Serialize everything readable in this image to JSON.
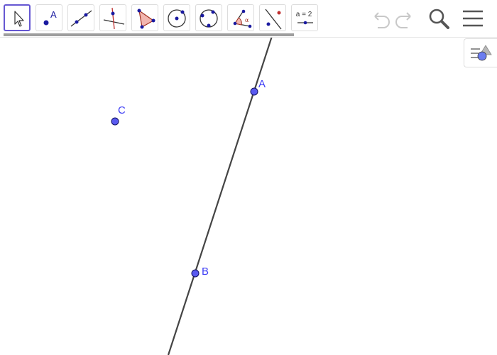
{
  "toolbar": {
    "tools": [
      {
        "name": "move-tool",
        "selected": true
      },
      {
        "name": "point-tool"
      },
      {
        "name": "line-tool"
      },
      {
        "name": "perpendicular-line-tool"
      },
      {
        "name": "polygon-tool"
      },
      {
        "name": "circle-tool"
      },
      {
        "name": "circle-through-3-points-tool"
      },
      {
        "name": "angle-tool"
      },
      {
        "name": "reflect-about-line-tool"
      },
      {
        "name": "slider-tool",
        "label": "a = 2"
      }
    ],
    "point_tool_label": "A",
    "angle_tool_label": "α"
  },
  "top_buttons": [
    "undo-icon",
    "redo-icon",
    "search-icon",
    "menu-icon"
  ],
  "style_bar_toggle": "style-bar-icon",
  "graphics": {
    "point_color": "#3d3df5",
    "line_color": "#444444",
    "label_color": "#3d3df5",
    "points": [
      {
        "label": "A"
      },
      {
        "label": "B"
      },
      {
        "label": "C"
      }
    ]
  }
}
